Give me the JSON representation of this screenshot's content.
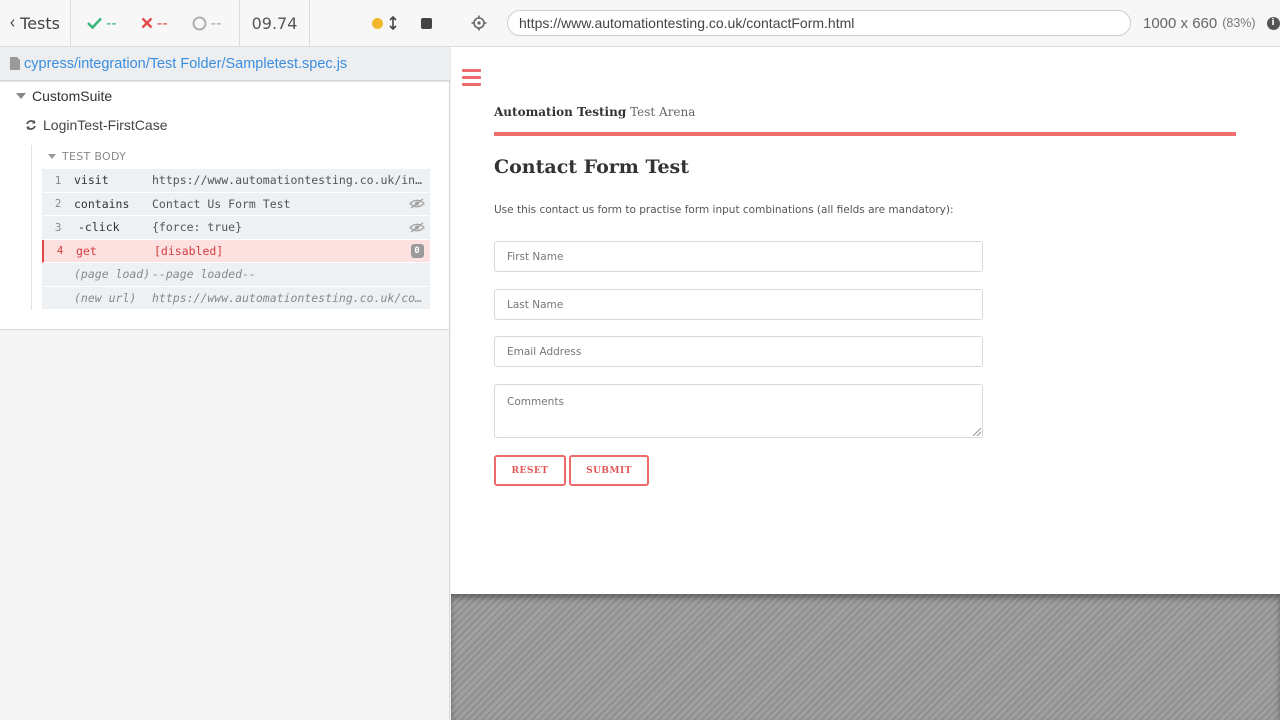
{
  "reporter": {
    "tests_label": "Tests",
    "passed": "--",
    "failed": "--",
    "pending": "--",
    "duration": "09.74",
    "colors": {
      "passed": "#3cb57b",
      "failed": "#e14a4a",
      "running": "#f3b72c"
    },
    "spec_path": "cypress/integration/Test Folder/Sampletest.spec.js",
    "suite": "CustomSuite",
    "test": "LoginTest-FirstCase",
    "test_body_label": "TEST BODY",
    "commands": [
      {
        "num": "1",
        "name": "visit",
        "message": "https://www.automationtesting.co.uk/index.html",
        "state": "passed"
      },
      {
        "num": "2",
        "name": "contains",
        "message": "Contact Us Form Test",
        "state": "passed",
        "icon": "eye-slash-icon"
      },
      {
        "num": "3",
        "name": "-click",
        "message": "{force: true}",
        "state": "passed",
        "icon": "eye-slash-icon"
      },
      {
        "num": "4",
        "name": "get",
        "message": "[disabled]",
        "state": "failed",
        "badge": "0"
      },
      {
        "num": "",
        "name": "(page load)",
        "message": "--page loaded--",
        "state": "event"
      },
      {
        "num": "",
        "name": "(new url)",
        "message": "https://www.automationtesting.co.uk/contactForm.html",
        "state": "event"
      }
    ]
  },
  "aut": {
    "url": "https://www.automationtesting.co.uk/contactForm.html",
    "viewport": "1000 x 660",
    "scale": "(83%)",
    "info": "i",
    "site": {
      "brand_bold": "Automation Testing",
      "brand_light": "Test Arena",
      "heading": "Contact Form Test",
      "description": "Use this contact us form to practise form input combinations (all fields are mandatory):",
      "fields": {
        "first_name": "First Name",
        "last_name": "Last Name",
        "email": "Email Address",
        "comments": "Comments"
      },
      "reset_label": "RESET",
      "submit_label": "SUBMIT",
      "accent": "#ef6f6f"
    }
  }
}
